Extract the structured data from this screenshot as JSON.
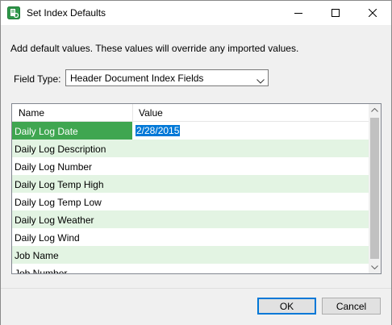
{
  "window": {
    "title": "Set Index Defaults"
  },
  "instructions": "Add default values. These values will override any imported values.",
  "field_type": {
    "label": "Field Type:",
    "selected": "Header Document Index Fields"
  },
  "grid": {
    "columns": {
      "name": "Name",
      "value": "Value"
    },
    "rows": [
      {
        "name": "Daily Log Date",
        "value": "2/28/2015"
      },
      {
        "name": "Daily Log Description",
        "value": ""
      },
      {
        "name": "Daily Log Number",
        "value": ""
      },
      {
        "name": "Daily Log Temp High",
        "value": ""
      },
      {
        "name": "Daily Log Temp Low",
        "value": ""
      },
      {
        "name": "Daily Log Weather",
        "value": ""
      },
      {
        "name": "Daily Log Wind",
        "value": ""
      },
      {
        "name": "Job Name",
        "value": ""
      },
      {
        "name": "Job Number",
        "value": ""
      }
    ]
  },
  "buttons": {
    "ok": "OK",
    "cancel": "Cancel"
  },
  "colors": {
    "selected_name_bg": "#3fa650",
    "alt_row_bg": "#e3f4e3",
    "text_selection": "#0078d7",
    "default_button_border": "#0078d7"
  }
}
